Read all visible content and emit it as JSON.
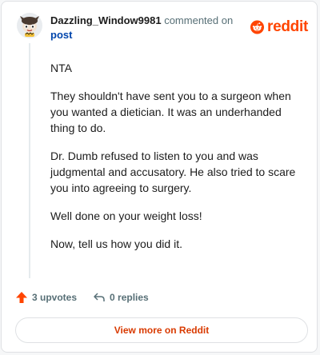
{
  "comment": {
    "username": "Dazzling_Window9981",
    "action_text": "commented on",
    "post_link": "post",
    "avatar_icon": "snoo-avatar-icon",
    "body": [
      "NTA",
      "They shouldn't have sent you to a surgeon when you wanted a dietician. It was an underhanded thing to do.",
      "Dr. Dumb refused to listen to you and was judgmental and accusatory. He also tried to scare you into agreeing to surgery.",
      "Well done on your weight loss!",
      "Now, tell us how you did it."
    ]
  },
  "brand": {
    "name": "reddit",
    "color": "#ff4500",
    "icon": "reddit-logo-icon"
  },
  "actions": {
    "upvotes": "3 upvotes",
    "replies": "0 replies",
    "upvote_icon": "upvote-arrow-icon",
    "reply_icon": "reply-arrow-icon",
    "upvote_color": "#ff4500"
  },
  "footer": {
    "view_more_label": "View more on Reddit"
  }
}
